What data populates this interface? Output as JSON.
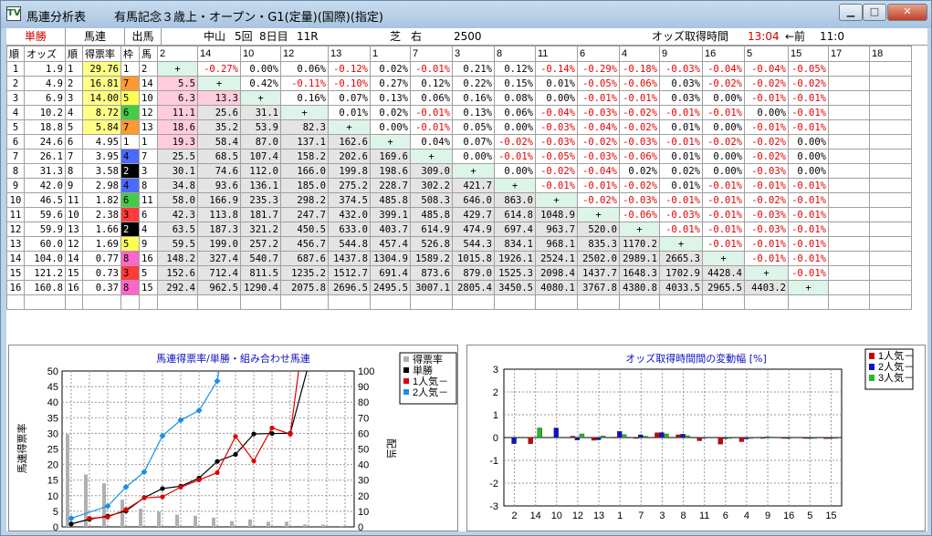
{
  "window": {
    "app_title": "馬連分析表",
    "race_title": "有馬記念３歳上・オープン・G1(定量)(国際)(指定)",
    "icon": "TV"
  },
  "header": {
    "tansho": "単勝",
    "umaren": "馬連",
    "shutsuba": "出馬",
    "venue": "中山",
    "kai": "5回",
    "day": "8日目",
    "race_no": "11R",
    "surface": "芝",
    "direction": "右",
    "distance": "2500",
    "odds_time_label": "オッズ取得時間",
    "odds_time": "13:04",
    "prev_label": "←前",
    "prev_time": "11:0"
  },
  "columns": {
    "jun": "順",
    "odds": "オッズ",
    "jun2": "順",
    "tokuhyo": "得票率",
    "waku": "枠",
    "uma": "馬",
    "pairs": [
      "2",
      "14",
      "10",
      "12",
      "13",
      "1",
      "7",
      "3",
      "8",
      "11",
      "6",
      "4",
      "9",
      "16",
      "5",
      "15",
      "17",
      "18"
    ]
  },
  "colors": {
    "waku": [
      "#ffffff",
      "#ffffff",
      "#000000",
      "#ff3b3b",
      "#4a6bff",
      "#ffff55",
      "#44cc44",
      "#ff9933",
      "#ff66cc"
    ],
    "hl_yellow": "#ffff88",
    "hl_pink": "#ffccdd",
    "plus": "#ddf5e8",
    "grey": "#e4e4e4",
    "neg": "#e00000",
    "accent": "#1010c0",
    "title_time": "#cc0000"
  },
  "rows": [
    {
      "jun": "1",
      "odds": "1.9",
      "j2": "1",
      "rate": "29.76",
      "waku": "1",
      "uma": "2",
      "cells": [
        "+",
        "-0.27%",
        "0.00%",
        "0.06%",
        "-0.12%",
        "0.02%",
        "-0.01%",
        "0.21%",
        "0.12%",
        "-0.14%",
        "-0.29%",
        "-0.18%",
        "-0.03%",
        "-0.04%",
        "-0.04%",
        "-0.05%",
        "",
        ""
      ]
    },
    {
      "jun": "2",
      "odds": "4.9",
      "j2": "2",
      "rate": "16.81",
      "waku": "7",
      "uma": "14",
      "cells": [
        "5.5",
        "+",
        "0.42%",
        "-0.11%",
        "-0.10%",
        "0.27%",
        "0.12%",
        "0.22%",
        "0.15%",
        "0.01%",
        "-0.05%",
        "-0.06%",
        "0.03%",
        "-0.02%",
        "-0.02%",
        "-0.02%",
        "",
        ""
      ]
    },
    {
      "jun": "3",
      "odds": "6.9",
      "j2": "3",
      "rate": "14.00",
      "waku": "5",
      "uma": "10",
      "cells": [
        "6.3",
        "13.3",
        "+",
        "0.16%",
        "0.07%",
        "0.13%",
        "0.06%",
        "0.16%",
        "0.08%",
        "0.00%",
        "-0.01%",
        "-0.01%",
        "0.03%",
        "0.00%",
        "-0.01%",
        "-0.01%",
        "",
        ""
      ]
    },
    {
      "jun": "4",
      "odds": "10.2",
      "j2": "4",
      "rate": "8.72",
      "waku": "6",
      "uma": "12",
      "cells": [
        "11.1",
        "25.6",
        "31.1",
        "+",
        "0.01%",
        "0.02%",
        "-0.01%",
        "0.13%",
        "0.06%",
        "-0.04%",
        "-0.03%",
        "-0.02%",
        "-0.01%",
        "-0.01%",
        "0.00%",
        "-0.01%",
        "",
        ""
      ]
    },
    {
      "jun": "5",
      "odds": "18.8",
      "j2": "5",
      "rate": "5.84",
      "waku": "7",
      "uma": "13",
      "cells": [
        "18.6",
        "35.2",
        "53.9",
        "82.3",
        "+",
        "0.00%",
        "-0.01%",
        "0.05%",
        "0.00%",
        "-0.03%",
        "-0.04%",
        "-0.02%",
        "0.01%",
        "0.00%",
        "-0.01%",
        "-0.01%",
        "",
        ""
      ]
    },
    {
      "jun": "6",
      "odds": "24.6",
      "j2": "6",
      "rate": "4.95",
      "waku": "1",
      "uma": "1",
      "cells": [
        "19.3",
        "58.4",
        "87.0",
        "137.1",
        "162.6",
        "+",
        "0.04%",
        "0.07%",
        "-0.02%",
        "-0.03%",
        "-0.02%",
        "-0.03%",
        "-0.01%",
        "-0.02%",
        "-0.02%",
        "0.00%",
        "",
        ""
      ]
    },
    {
      "jun": "7",
      "odds": "26.1",
      "j2": "7",
      "rate": "3.95",
      "waku": "4",
      "uma": "7",
      "cells": [
        "25.5",
        "68.5",
        "107.4",
        "158.2",
        "202.6",
        "169.6",
        "+",
        "0.00%",
        "-0.01%",
        "-0.05%",
        "-0.03%",
        "-0.06%",
        "0.01%",
        "0.00%",
        "-0.02%",
        "0.00%",
        "",
        ""
      ]
    },
    {
      "jun": "8",
      "odds": "31.3",
      "j2": "8",
      "rate": "3.58",
      "waku": "2",
      "uma": "3",
      "cells": [
        "30.1",
        "74.6",
        "112.0",
        "166.0",
        "199.8",
        "198.6",
        "309.0",
        "+",
        "0.00%",
        "-0.02%",
        "-0.04%",
        "0.02%",
        "0.02%",
        "0.00%",
        "-0.03%",
        "0.00%",
        "",
        ""
      ]
    },
    {
      "jun": "9",
      "odds": "42.0",
      "j2": "9",
      "rate": "2.98",
      "waku": "4",
      "uma": "8",
      "cells": [
        "34.8",
        "93.6",
        "136.1",
        "185.0",
        "275.2",
        "228.7",
        "302.2",
        "421.7",
        "+",
        "-0.01%",
        "-0.01%",
        "-0.02%",
        "0.01%",
        "-0.01%",
        "-0.01%",
        "-0.01%",
        "",
        ""
      ]
    },
    {
      "jun": "10",
      "odds": "46.5",
      "j2": "11",
      "rate": "1.82",
      "waku": "6",
      "uma": "11",
      "cells": [
        "58.0",
        "166.9",
        "235.3",
        "298.2",
        "374.5",
        "485.8",
        "508.3",
        "646.0",
        "863.0",
        "+",
        "-0.02%",
        "-0.03%",
        "-0.01%",
        "-0.01%",
        "-0.02%",
        "-0.01%",
        "",
        ""
      ]
    },
    {
      "jun": "11",
      "odds": "59.6",
      "j2": "10",
      "rate": "2.38",
      "waku": "3",
      "uma": "6",
      "cells": [
        "42.3",
        "113.8",
        "181.7",
        "247.7",
        "432.0",
        "399.1",
        "485.8",
        "429.7",
        "614.8",
        "1048.9",
        "+",
        "-0.06%",
        "-0.03%",
        "-0.01%",
        "-0.03%",
        "-0.01%",
        "",
        ""
      ]
    },
    {
      "jun": "12",
      "odds": "59.9",
      "j2": "13",
      "rate": "1.66",
      "waku": "2",
      "uma": "4",
      "cells": [
        "63.5",
        "187.3",
        "321.2",
        "450.5",
        "633.0",
        "403.7",
        "614.9",
        "474.9",
        "697.4",
        "963.7",
        "520.0",
        "+",
        "-0.01%",
        "-0.01%",
        "-0.03%",
        "-0.01%",
        "",
        ""
      ]
    },
    {
      "jun": "13",
      "odds": "60.0",
      "j2": "12",
      "rate": "1.69",
      "waku": "5",
      "uma": "9",
      "cells": [
        "59.5",
        "199.0",
        "257.2",
        "456.7",
        "544.8",
        "457.4",
        "526.8",
        "544.3",
        "834.1",
        "968.1",
        "835.3",
        "1170.2",
        "+",
        "-0.01%",
        "-0.01%",
        "-0.01%",
        "",
        ""
      ]
    },
    {
      "jun": "14",
      "odds": "104.0",
      "j2": "14",
      "rate": "0.77",
      "waku": "8",
      "uma": "16",
      "cells": [
        "148.2",
        "327.4",
        "540.7",
        "687.6",
        "1437.8",
        "1304.9",
        "1589.2",
        "1015.8",
        "1926.1",
        "2524.1",
        "2502.0",
        "2989.1",
        "2665.3",
        "+",
        "-0.01%",
        "-0.01%",
        "",
        ""
      ]
    },
    {
      "jun": "15",
      "odds": "121.2",
      "j2": "15",
      "rate": "0.73",
      "waku": "3",
      "uma": "5",
      "cells": [
        "152.6",
        "712.4",
        "811.5",
        "1235.2",
        "1512.7",
        "691.4",
        "873.6",
        "879.0",
        "1525.3",
        "2098.4",
        "1437.7",
        "1648.3",
        "1702.9",
        "4428.4",
        "+",
        "-0.01%",
        "",
        ""
      ]
    },
    {
      "jun": "16",
      "odds": "160.8",
      "j2": "16",
      "rate": "0.37",
      "waku": "8",
      "uma": "15",
      "cells": [
        "292.4",
        "962.5",
        "1290.4",
        "2075.8",
        "2696.5",
        "2495.5",
        "3007.1",
        "2805.4",
        "3450.5",
        "4080.1",
        "3767.8",
        "4380.8",
        "4033.5",
        "2965.5",
        "4403.2",
        "+",
        "",
        ""
      ]
    }
  ],
  "chart_left": {
    "title": "馬連得票率/単勝・組み合わせ馬連",
    "ylabel_left": "馬連得票率",
    "ylabel_right": "配当",
    "ylim_left": [
      0,
      50
    ],
    "ylim_right": [
      0,
      100
    ],
    "yticks_left": [
      "0",
      "5",
      "10",
      "15",
      "20",
      "25",
      "30",
      "35",
      "40",
      "45",
      "50"
    ],
    "yticks_right": [
      "0",
      "10",
      "20",
      "30",
      "40",
      "50",
      "60",
      "70",
      "80",
      "90",
      "100"
    ],
    "categories": [
      "2",
      "14",
      "10",
      "12",
      "13",
      "1",
      "7",
      "3",
      "8",
      "11",
      "6",
      "4",
      "9",
      "16",
      "5",
      "15"
    ],
    "legend": [
      "得票率",
      "単勝",
      "1人気－",
      "2人気－"
    ],
    "chart_data": {
      "type": "bar+line",
      "categories": [
        "2",
        "14",
        "10",
        "12",
        "13",
        "1",
        "7",
        "3",
        "8",
        "11",
        "6",
        "4",
        "9",
        "16",
        "5",
        "15"
      ],
      "series": [
        {
          "name": "得票率",
          "axis": "left",
          "values": [
            29.76,
            16.81,
            14.0,
            8.72,
            5.84,
            4.95,
            3.95,
            3.58,
            2.98,
            1.82,
            2.38,
            1.66,
            1.69,
            0.77,
            0.73,
            0.37
          ]
        },
        {
          "name": "単勝",
          "axis": "right",
          "values": [
            1.9,
            4.9,
            6.9,
            10.2,
            18.8,
            24.6,
            26.1,
            31.3,
            42.0,
            46.5,
            59.6,
            59.9,
            60.0,
            104.0,
            121.2,
            160.8
          ]
        },
        {
          "name": "1人気－",
          "axis": "right",
          "values": [
            null,
            5.5,
            6.3,
            11.1,
            18.6,
            19.3,
            25.5,
            30.1,
            34.8,
            58.0,
            42.3,
            63.5,
            59.5,
            148.2,
            152.6,
            292.4
          ]
        },
        {
          "name": "2人気－",
          "axis": "right",
          "values": [
            5.5,
            null,
            13.3,
            25.6,
            35.2,
            58.4,
            68.5,
            74.6,
            93.6,
            166.9,
            113.8,
            187.3,
            199.0,
            327.4,
            712.4,
            962.5
          ]
        }
      ]
    }
  },
  "chart_right": {
    "title": "オッズ取得時間間の変動幅 [%]",
    "ylim": [
      -3,
      3
    ],
    "yticks": [
      "3",
      "2",
      "1",
      "0",
      "-1",
      "-2",
      "-3"
    ],
    "categories": [
      "2",
      "14",
      "10",
      "12",
      "13",
      "1",
      "7",
      "3",
      "8",
      "11",
      "6",
      "4",
      "9",
      "16",
      "5",
      "15"
    ],
    "legend": [
      "1人気－",
      "2人気－",
      "3人気－"
    ],
    "chart_data": {
      "type": "bar",
      "categories": [
        "2",
        "14",
        "10",
        "12",
        "13",
        "1",
        "7",
        "3",
        "8",
        "11",
        "6",
        "4",
        "9",
        "16",
        "5",
        "15"
      ],
      "series": [
        {
          "name": "1人気－",
          "values": [
            0,
            -0.27,
            0.0,
            0.06,
            -0.12,
            0.02,
            -0.01,
            0.21,
            0.12,
            -0.14,
            -0.29,
            -0.18,
            -0.03,
            -0.04,
            -0.04,
            -0.05
          ]
        },
        {
          "name": "2人気－",
          "values": [
            -0.27,
            0,
            0.42,
            -0.11,
            -0.1,
            0.27,
            0.12,
            0.22,
            0.15,
            0.01,
            -0.05,
            -0.06,
            0.03,
            -0.02,
            -0.02,
            -0.02
          ]
        },
        {
          "name": "3人気－",
          "values": [
            0.0,
            0.42,
            0,
            0.16,
            0.07,
            0.13,
            0.06,
            0.16,
            0.08,
            0.0,
            -0.01,
            -0.01,
            0.03,
            0.0,
            -0.01,
            -0.01
          ]
        }
      ]
    }
  }
}
